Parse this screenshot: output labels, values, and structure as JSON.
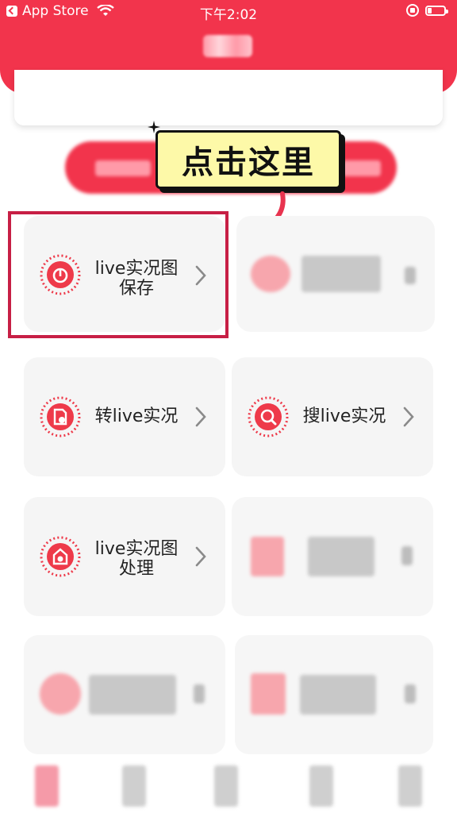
{
  "status_bar": {
    "back_app": "App Store",
    "time": "下午2:02",
    "battery_level": 0.25
  },
  "callout": {
    "text": "点击这里"
  },
  "tools": [
    {
      "id": "live-save",
      "label_line1": "live实况图",
      "label_line2": "保存",
      "icon": "live-photo-save-icon"
    },
    {
      "id": "convert-live",
      "label_line1": "转live实况",
      "label_line2": "",
      "icon": "convert-image-icon"
    },
    {
      "id": "search-live",
      "label_line1": "搜live实况",
      "label_line2": "",
      "icon": "search-live-icon"
    },
    {
      "id": "live-process",
      "label_line1": "live实况图",
      "label_line2": "处理",
      "icon": "image-process-icon"
    }
  ],
  "colors": {
    "brand_red": "#f2344c",
    "highlight_border": "#c71f45",
    "callout_bg": "#fdf9a8",
    "card_bg": "#f5f5f5"
  }
}
